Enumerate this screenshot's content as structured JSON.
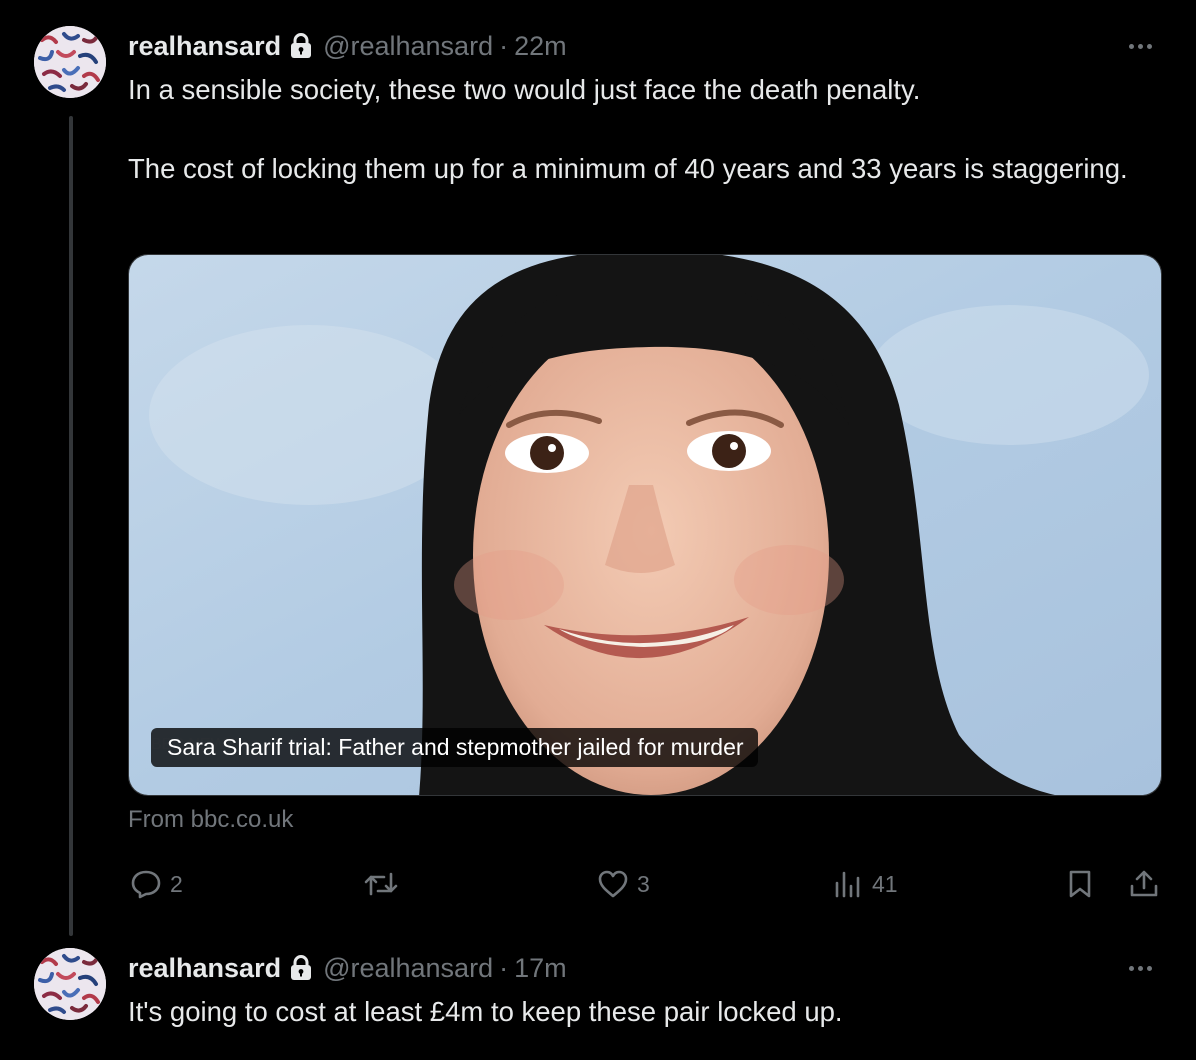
{
  "tweets": [
    {
      "display_name": "realhansard",
      "handle": "@realhansard",
      "separator": "·",
      "time": "22m",
      "text_line1": "In a sensible society, these two would just face the death penalty.",
      "text_line2": "The cost of locking them up for a minimum of 40 years and 33 years is staggering.",
      "card": {
        "title": "Sara Sharif trial: Father and stepmother jailed for murder",
        "source": "From bbc.co.uk"
      },
      "actions": {
        "replies": "2",
        "retweets": "",
        "likes": "3",
        "views": "41"
      }
    },
    {
      "display_name": "realhansard",
      "handle": "@realhansard",
      "separator": "·",
      "time": "17m",
      "text": "It's going to cost at least £4m to keep these pair locked up."
    }
  ],
  "icons": {
    "lock": "lock-icon",
    "more": "more-icon",
    "reply": "reply-icon",
    "retweet": "retweet-icon",
    "like": "like-icon",
    "views": "views-icon",
    "bookmark": "bookmark-icon",
    "share": "share-icon"
  },
  "colors": {
    "background": "#000000",
    "text": "#e7e9ea",
    "muted": "#71767b",
    "border": "#333639"
  }
}
